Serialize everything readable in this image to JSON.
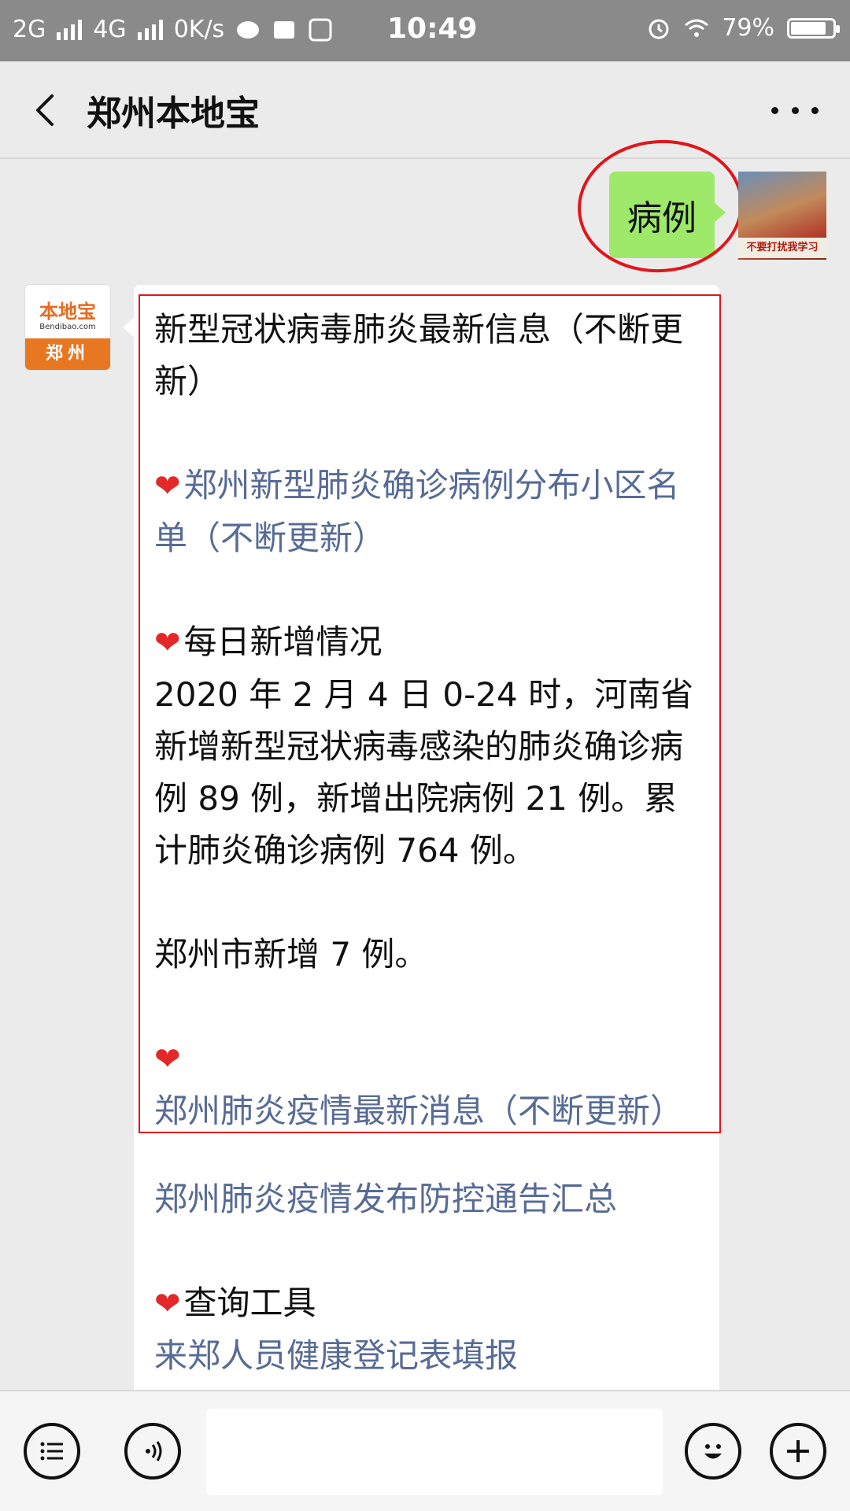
{
  "status_bar": {
    "network_1": "2G",
    "network_2": "4G",
    "speed": "0K/s",
    "time": "10:49",
    "battery": "79%",
    "battery_level": 0.79
  },
  "nav": {
    "title": "郑州本地宝"
  },
  "user_message": {
    "text": "病例",
    "avatar_caption": "不要打扰我学习"
  },
  "bot_avatar": {
    "brand": "本地宝",
    "url": "Bendibao.com",
    "city": "郑州"
  },
  "bot_message": {
    "title": "新型冠状病毒肺炎最新信息（不断更新）",
    "link_1": "郑州新型肺炎确诊病例分布小区名单（不断更新）",
    "section_daily": "每日新增情况",
    "daily_text": "2020 年 2 月 4 日 0-24 时，河南省新增新型冠状病毒感染的肺炎确诊病例 89 例，新增出院病例 21 例。累计肺炎确诊病例 764 例。",
    "zhengzhou_text": "郑州市新增 7 例。",
    "link_2": "郑州肺炎疫情最新消息（不断更新）",
    "link_3": "郑州肺炎疫情发布防控通告汇总",
    "section_tools": "查询工具",
    "link_4": "来郑人员健康登记表填报"
  },
  "colors": {
    "link": "#576b95",
    "user_bubble": "#9ee86a",
    "annotation": "#e0161b"
  },
  "icons": [
    "back-icon",
    "more-icon",
    "menu-list-icon",
    "voice-icon",
    "emoji-icon",
    "plus-icon",
    "heart-icon"
  ]
}
